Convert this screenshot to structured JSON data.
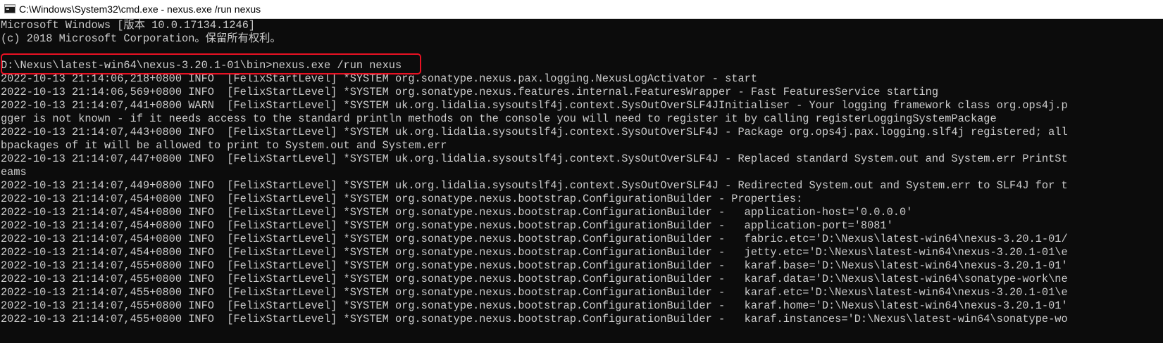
{
  "window": {
    "title": "C:\\Windows\\System32\\cmd.exe - nexus.exe  /run nexus",
    "icon": "cmd-icon"
  },
  "console": {
    "lines": [
      "Microsoft Windows [版本 10.0.17134.1246]",
      "(c) 2018 Microsoft Corporation。保留所有权利。",
      "",
      "D:\\Nexus\\latest-win64\\nexus-3.20.1-01\\bin>nexus.exe /run nexus",
      "2022-10-13 21:14:06,218+0800 INFO  [FelixStartLevel] *SYSTEM org.sonatype.nexus.pax.logging.NexusLogActivator - start",
      "2022-10-13 21:14:06,569+0800 INFO  [FelixStartLevel] *SYSTEM org.sonatype.nexus.features.internal.FeaturesWrapper - Fast FeaturesService starting",
      "2022-10-13 21:14:07,441+0800 WARN  [FelixStartLevel] *SYSTEM uk.org.lidalia.sysoutslf4j.context.SysOutOverSLF4JInitialiser - Your logging framework class org.ops4j.p",
      "gger is not known - if it needs access to the standard println methods on the console you will need to register it by calling registerLoggingSystemPackage",
      "2022-10-13 21:14:07,443+0800 INFO  [FelixStartLevel] *SYSTEM uk.org.lidalia.sysoutslf4j.context.SysOutOverSLF4J - Package org.ops4j.pax.logging.slf4j registered; all",
      "bpackages of it will be allowed to print to System.out and System.err",
      "2022-10-13 21:14:07,447+0800 INFO  [FelixStartLevel] *SYSTEM uk.org.lidalia.sysoutslf4j.context.SysOutOverSLF4J - Replaced standard System.out and System.err PrintSt",
      "eams",
      "2022-10-13 21:14:07,449+0800 INFO  [FelixStartLevel] *SYSTEM uk.org.lidalia.sysoutslf4j.context.SysOutOverSLF4J - Redirected System.out and System.err to SLF4J for t",
      "2022-10-13 21:14:07,454+0800 INFO  [FelixStartLevel] *SYSTEM org.sonatype.nexus.bootstrap.ConfigurationBuilder - Properties:",
      "2022-10-13 21:14:07,454+0800 INFO  [FelixStartLevel] *SYSTEM org.sonatype.nexus.bootstrap.ConfigurationBuilder -   application-host='0.0.0.0'",
      "2022-10-13 21:14:07,454+0800 INFO  [FelixStartLevel] *SYSTEM org.sonatype.nexus.bootstrap.ConfigurationBuilder -   application-port='8081'",
      "2022-10-13 21:14:07,454+0800 INFO  [FelixStartLevel] *SYSTEM org.sonatype.nexus.bootstrap.ConfigurationBuilder -   fabric.etc='D:\\Nexus\\latest-win64\\nexus-3.20.1-01/",
      "2022-10-13 21:14:07,454+0800 INFO  [FelixStartLevel] *SYSTEM org.sonatype.nexus.bootstrap.ConfigurationBuilder -   jetty.etc='D:\\Nexus\\latest-win64\\nexus-3.20.1-01\\e",
      "2022-10-13 21:14:07,455+0800 INFO  [FelixStartLevel] *SYSTEM org.sonatype.nexus.bootstrap.ConfigurationBuilder -   karaf.base='D:\\Nexus\\latest-win64\\nexus-3.20.1-01'",
      "2022-10-13 21:14:07,455+0800 INFO  [FelixStartLevel] *SYSTEM org.sonatype.nexus.bootstrap.ConfigurationBuilder -   karaf.data='D:\\Nexus\\latest-win64\\sonatype-work\\ne",
      "2022-10-13 21:14:07,455+0800 INFO  [FelixStartLevel] *SYSTEM org.sonatype.nexus.bootstrap.ConfigurationBuilder -   karaf.etc='D:\\Nexus\\latest-win64\\nexus-3.20.1-01\\e",
      "2022-10-13 21:14:07,455+0800 INFO  [FelixStartLevel] *SYSTEM org.sonatype.nexus.bootstrap.ConfigurationBuilder -   karaf.home='D:\\Nexus\\latest-win64\\nexus-3.20.1-01'",
      "2022-10-13 21:14:07,455+0800 INFO  [FelixStartLevel] *SYSTEM org.sonatype.nexus.bootstrap.ConfigurationBuilder -   karaf.instances='D:\\Nexus\\latest-win64\\sonatype-wo"
    ]
  },
  "colors": {
    "console_bg": "#0c0c0c",
    "console_text": "#cccccc",
    "highlight": "#e81123",
    "titlebar_bg": "#ffffff"
  }
}
